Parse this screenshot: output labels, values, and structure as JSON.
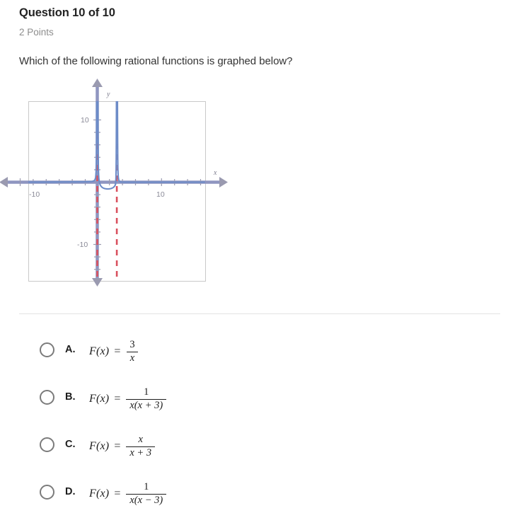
{
  "header": {
    "title": "Question 10 of 10",
    "points": "2 Points",
    "prompt": "Which of the following rational functions is graphed below?"
  },
  "graph": {
    "axis_label_x": "x",
    "axis_label_y": "y",
    "x_tick_left": "-10",
    "x_tick_right": "10",
    "y_tick_top": "10",
    "y_tick_bottom": "-10",
    "curve_color": "#6d8cc8",
    "asymptote_color": "#d94f5c",
    "axis_color": "#9a9ab0",
    "border_color": "#c9c9c9"
  },
  "chart_data": {
    "type": "line",
    "title": "",
    "xlabel": "x",
    "ylabel": "y",
    "xlim": [
      -14,
      14
    ],
    "ylim": [
      -16,
      16
    ],
    "grid": false,
    "legend": "none",
    "xticks": [
      -10,
      10
    ],
    "yticks": [
      10,
      -10
    ],
    "xtick_labels": [
      "-10",
      "10"
    ],
    "ytick_labels": [
      "10",
      "-10"
    ],
    "function": "F(x) = 1 / (x(x - 3))",
    "vertical_asymptotes": [
      0,
      3
    ],
    "horizontal_asymptote": 0,
    "annotations": [
      "Branch left of x = 0 rises to +infinity as x approaches 0 from the left",
      "Branch between x = 0 and x = 3 is an arch opening downward with maximum near y = -0.44 at x = 1.5",
      "Branch right of x = 3 rises to +infinity as x approaches 3 from the right"
    ],
    "series": [
      {
        "name": "left-branch",
        "x": [
          -14,
          -12,
          -10,
          -8,
          -6,
          -5,
          -4,
          -3,
          -2,
          -1.5,
          -1,
          -0.7,
          -0.5,
          -0.35,
          -0.25,
          -0.18,
          -0.12,
          -0.08
        ],
        "y": [
          0.0042,
          0.0056,
          0.0077,
          0.0114,
          0.0185,
          0.025,
          0.0357,
          0.0556,
          0.1,
          0.1481,
          0.25,
          0.3859,
          0.5714,
          0.8537,
          1.2308,
          1.7483,
          2.6738,
          4.0584
        ]
      },
      {
        "name": "middle-branch",
        "x": [
          0.08,
          0.12,
          0.18,
          0.25,
          0.4,
          0.6,
          0.9,
          1.2,
          1.5,
          1.8,
          2.1,
          2.4,
          2.6,
          2.75,
          2.85,
          2.92,
          2.96
        ],
        "y": [
          -4.283,
          -2.894,
          -1.975,
          -1.455,
          -0.962,
          -0.694,
          -0.529,
          -0.463,
          -0.444,
          -0.463,
          -0.529,
          -0.694,
          -0.962,
          -1.455,
          -2.339,
          -4.283,
          -8.446
        ]
      },
      {
        "name": "right-branch",
        "x": [
          3.04,
          3.08,
          3.15,
          3.25,
          3.5,
          4,
          5,
          6,
          8,
          10,
          12,
          14
        ],
        "y": [
          8.22,
          4.11,
          2.12,
          1.23,
          0.571,
          0.25,
          0.1,
          0.0556,
          0.025,
          0.0143,
          0.00926,
          0.0065
        ]
      }
    ]
  },
  "answers": [
    {
      "letter": "A.",
      "fx": "F(x)",
      "equals": "=",
      "numerator": "3",
      "denominator": "x"
    },
    {
      "letter": "B.",
      "fx": "F(x)",
      "equals": "=",
      "numerator": "1",
      "denominator": "x(x + 3)"
    },
    {
      "letter": "C.",
      "fx": "F(x)",
      "equals": "=",
      "numerator": "x",
      "denominator": "x + 3"
    },
    {
      "letter": "D.",
      "fx": "F(x)",
      "equals": "=",
      "numerator": "1",
      "denominator": "x(x − 3)"
    }
  ]
}
